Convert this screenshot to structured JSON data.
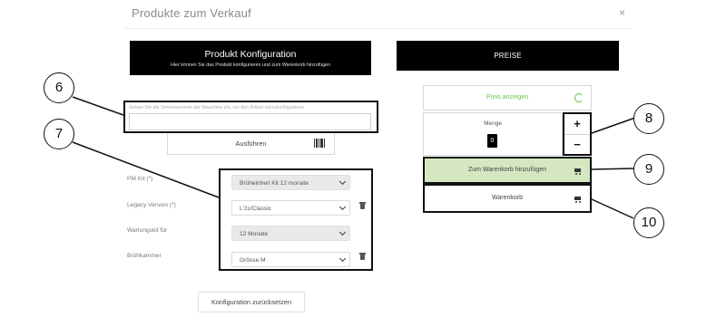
{
  "modal": {
    "title": "Produkte zum Verkauf",
    "close": "×"
  },
  "config": {
    "title": "Produkt Konfiguration",
    "subtitle": "Hier können Sie das Produkt konfigurieren und zum Warenkorb hinzufügen"
  },
  "prices": {
    "title": "PREISE"
  },
  "serial": {
    "placeholder": "Geben Sie die Seriennummer der Maschine ein, um den Artikel vorzukonfigurieren",
    "value": "",
    "run_label": "Ausführen"
  },
  "form": {
    "fields": [
      {
        "label": "PM Kit (*)",
        "value": "Brüheinheit Kit 12 monate"
      },
      {
        "label": "Legacy Version (*)",
        "value": "L'2c/Classic"
      },
      {
        "label": "Wartungskit für",
        "value": "12 Monate"
      },
      {
        "label": "Brühkammer",
        "value": "Grösse M"
      }
    ],
    "reset_label": "Konfiguration zurücksetzen"
  },
  "cart": {
    "show_price": "Preis anzeigen",
    "quantity_label": "Menge",
    "quantity": "0",
    "plus": "+",
    "minus": "−",
    "add_to_cart": "Zum Warenkorb hinzufügen",
    "view_cart": "Warenkorb"
  },
  "callouts": [
    "6",
    "7",
    "8",
    "9",
    "10"
  ],
  "colors": {
    "accent_green": "#6dbf4b",
    "cart_bg": "#d4e7c1",
    "banner": "#000000"
  }
}
